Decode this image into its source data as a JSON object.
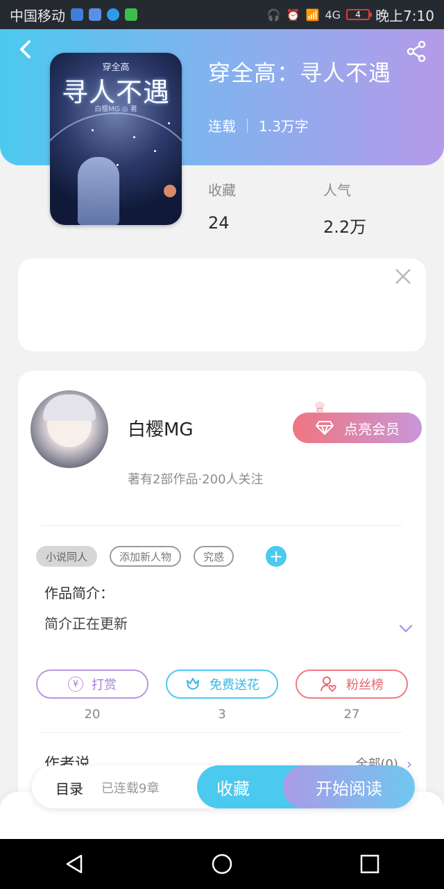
{
  "status_bar": {
    "carrier": "中国移动",
    "time": "晚上7:10",
    "battery": "4",
    "network": "4G"
  },
  "book": {
    "title": "穿全高：寻人不遇",
    "status": "连载",
    "word_count": "1.3万字",
    "cover": {
      "series": "穿全高",
      "title": "寻人不遇",
      "author_credit": "白樱MG ◎ 著"
    },
    "stats": {
      "favorites_label": "收藏",
      "favorites_value": "24",
      "popularity_label": "人气",
      "popularity_value": "2.2万"
    }
  },
  "author": {
    "name": "白樱MG",
    "info": "著有2部作品·200人关注",
    "vip_button": "点亮会员"
  },
  "tags": [
    "小说同人",
    "添加新人物",
    "究惑"
  ],
  "intro": {
    "label": "作品简介：",
    "text": "简介正在更新"
  },
  "actions": {
    "reward_label": "打赏",
    "reward_count": "20",
    "flower_label": "免费送花",
    "flower_count": "3",
    "fans_label": "粉丝榜",
    "fans_count": "27"
  },
  "author_says": {
    "label": "作者说",
    "all_link": "全部(0)"
  },
  "bottom_bar": {
    "toc_label": "目录",
    "toc_sub": "已连载9章",
    "favorite_button": "收藏",
    "read_button": "开始阅读"
  },
  "colors": {
    "accent_cyan": "#4bc9ef",
    "accent_purple": "#b49ae9",
    "vip_pink": "#f07580"
  }
}
